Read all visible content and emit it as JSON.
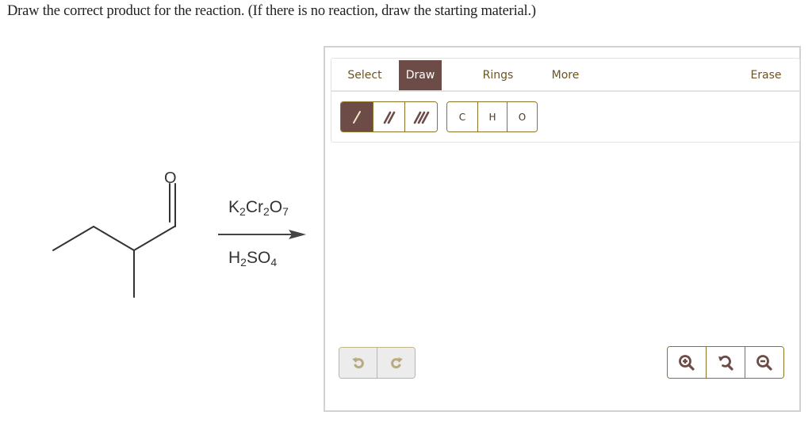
{
  "question": {
    "text": "Draw the correct product for the reaction. (If there is no reaction, draw the starting material.)"
  },
  "reaction": {
    "starting_material": "2-methylbutanal",
    "carbonyl_atom_label": "O",
    "reagent_above": {
      "parts": [
        "K",
        "2",
        "Cr",
        "2",
        "O",
        "7"
      ]
    },
    "reagent_below": {
      "parts": [
        "H",
        "2",
        "SO",
        "4"
      ]
    }
  },
  "editor": {
    "tabs": [
      {
        "label": "Select",
        "active": false
      },
      {
        "label": "Draw",
        "active": true
      },
      {
        "label": "Rings",
        "active": false
      },
      {
        "label": "More",
        "active": false
      }
    ],
    "erase_label": "Erase",
    "bond_tools": [
      {
        "name": "single-bond",
        "active": true
      },
      {
        "name": "double-bond",
        "active": false
      },
      {
        "name": "triple-bond",
        "active": false
      }
    ],
    "atom_tools": [
      "C",
      "H",
      "O"
    ],
    "history_tools": [
      "undo",
      "redo"
    ],
    "view_tools": [
      "zoom-in",
      "reset-view",
      "zoom-out"
    ],
    "colors": {
      "accent": "#6d4c47",
      "label": "#6b5420",
      "border": "#8a7227",
      "disabled_border": "#c4b58a",
      "disabled_icon": "#b8ab80"
    }
  }
}
